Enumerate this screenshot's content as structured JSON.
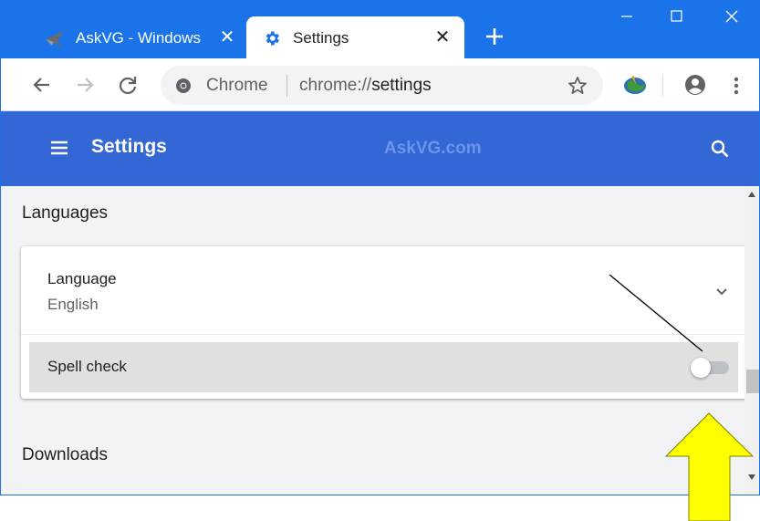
{
  "tabs": [
    {
      "title": "AskVG - Windows",
      "icon": "askvg-favicon",
      "active": false
    },
    {
      "title": "Settings",
      "icon": "settings-gear-icon",
      "active": true
    }
  ],
  "tab_close_glyph": "✕",
  "window_controls": {
    "minimize": "minimize-icon",
    "maximize": "maximize-icon",
    "close": "close-icon"
  },
  "omnibox": {
    "site_name": "Chrome",
    "url_scheme": "chrome://",
    "url_host": "settings"
  },
  "settings_header": {
    "title": "Settings",
    "watermark": "AskVG.com"
  },
  "languages": {
    "section_title": "Languages",
    "language_label": "Language",
    "language_value": "English",
    "spell_check_label": "Spell check",
    "spell_check_enabled": false
  },
  "downloads": {
    "section_title": "Downloads"
  },
  "colors": {
    "tabstrip": "#1a73e8",
    "settings_header": "#3367d6",
    "content_bg": "#f1f3f4",
    "highlight_row": "#e0e0e0",
    "annotation_arrow": "#ffff00"
  }
}
